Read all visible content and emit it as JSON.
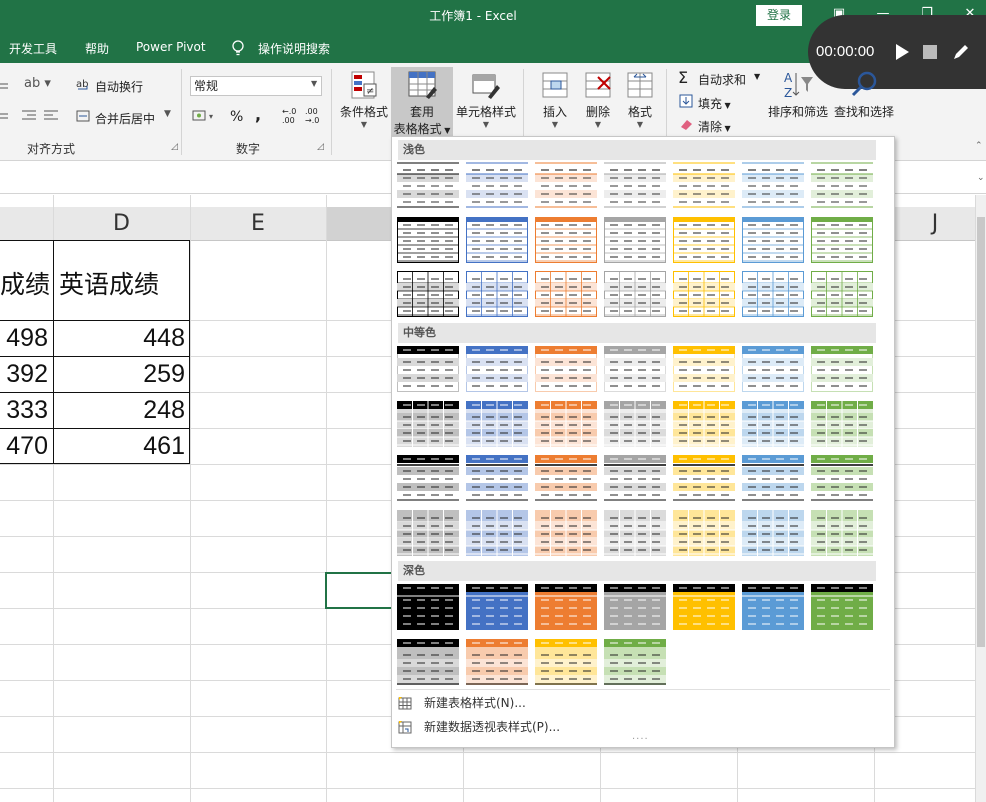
{
  "titlebar": {
    "title": "工作簿1  -  Excel",
    "login_label": "登录",
    "minimize_glyph": "—",
    "restore_glyph": "❐",
    "close_glyph": "✕"
  },
  "menubar": {
    "items": [
      "开发工具",
      "帮助",
      "Power Pivot",
      "操作说明搜索"
    ]
  },
  "recorder": {
    "time": "00:00:00"
  },
  "ribbon": {
    "wrap_text": "自动换行",
    "merge_center": "合并后居中",
    "align_group": "对齐方式",
    "number_format": "常规",
    "percent": "%",
    "comma": ",",
    "dec_inc": "←.0\n.00",
    "dec_dec": ".00\n→.0",
    "number_group": "数字",
    "cond_format": "条件格式",
    "table_format_1": "套用",
    "table_format_2": "表格格式",
    "cell_style": "单元格样式",
    "insert": "插入",
    "delete": "删除",
    "format": "格式",
    "autosum": "自动求和",
    "fill": "填充",
    "clear": "清除",
    "sort_filter": "排序和筛选",
    "find_select": "查找和选择"
  },
  "sheet": {
    "columns": [
      {
        "label": "D"
      },
      {
        "label": "E"
      },
      {
        "label": "J"
      }
    ],
    "header_partial": "成绩",
    "header_d": "英语成绩",
    "rows": [
      {
        "c": "498",
        "d": "448"
      },
      {
        "c": "392",
        "d": "259"
      },
      {
        "c": "333",
        "d": "248"
      },
      {
        "c": "470",
        "d": "461"
      }
    ]
  },
  "gallery": {
    "sections": [
      "浅色",
      "中等色",
      "深色"
    ],
    "menu": [
      "新建表格样式(N)...",
      "新建数据透视表样式(P)..."
    ],
    "colors": [
      "#000000",
      "#4472c4",
      "#ed7d31",
      "#a5a5a5",
      "#ffc000",
      "#5b9bd5",
      "#70ad47"
    ],
    "light_tints": [
      "#d9d9d9",
      "#d9e1f2",
      "#fce4d6",
      "#ededed",
      "#fff2cc",
      "#ddebf7",
      "#e2efda"
    ],
    "mid_tints": [
      "#bfbfbf",
      "#b4c6e7",
      "#f8cbad",
      "#dbdbdb",
      "#ffe699",
      "#bdd7ee",
      "#c6e0b4"
    ]
  }
}
